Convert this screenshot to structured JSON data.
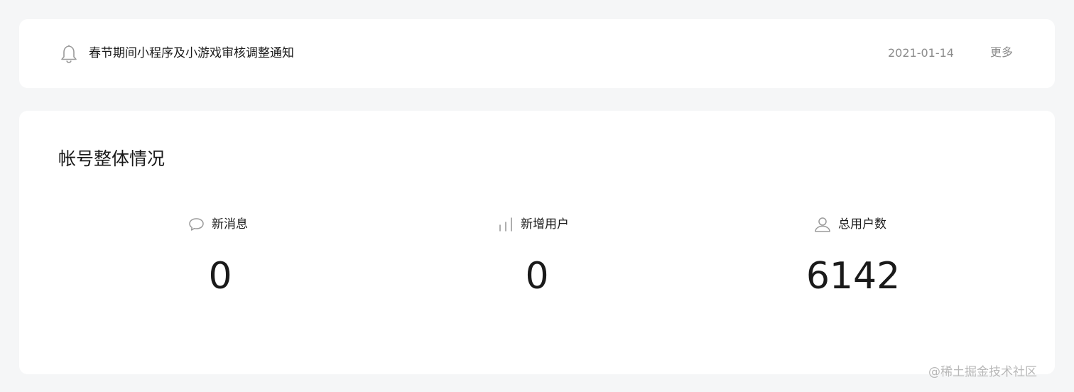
{
  "notice": {
    "title": "春节期间小程序及小游戏审核调整通知",
    "date": "2021-01-14",
    "more_label": "更多",
    "icon": "bell-icon"
  },
  "overview": {
    "title": "帐号整体情况",
    "stats": [
      {
        "label": "新消息",
        "value": "0",
        "icon": "chat-bubble-icon"
      },
      {
        "label": "新增用户",
        "value": "0",
        "icon": "bar-chart-icon"
      },
      {
        "label": "总用户数",
        "value": "6142",
        "icon": "user-icon"
      }
    ]
  },
  "watermark": {
    "text": "@稀土掘金技术社区"
  },
  "colors": {
    "page_background": "#f5f6f7",
    "card_background": "#ffffff",
    "muted_text": "#8c8c8c",
    "icon_gray": "#9a9a9a"
  }
}
